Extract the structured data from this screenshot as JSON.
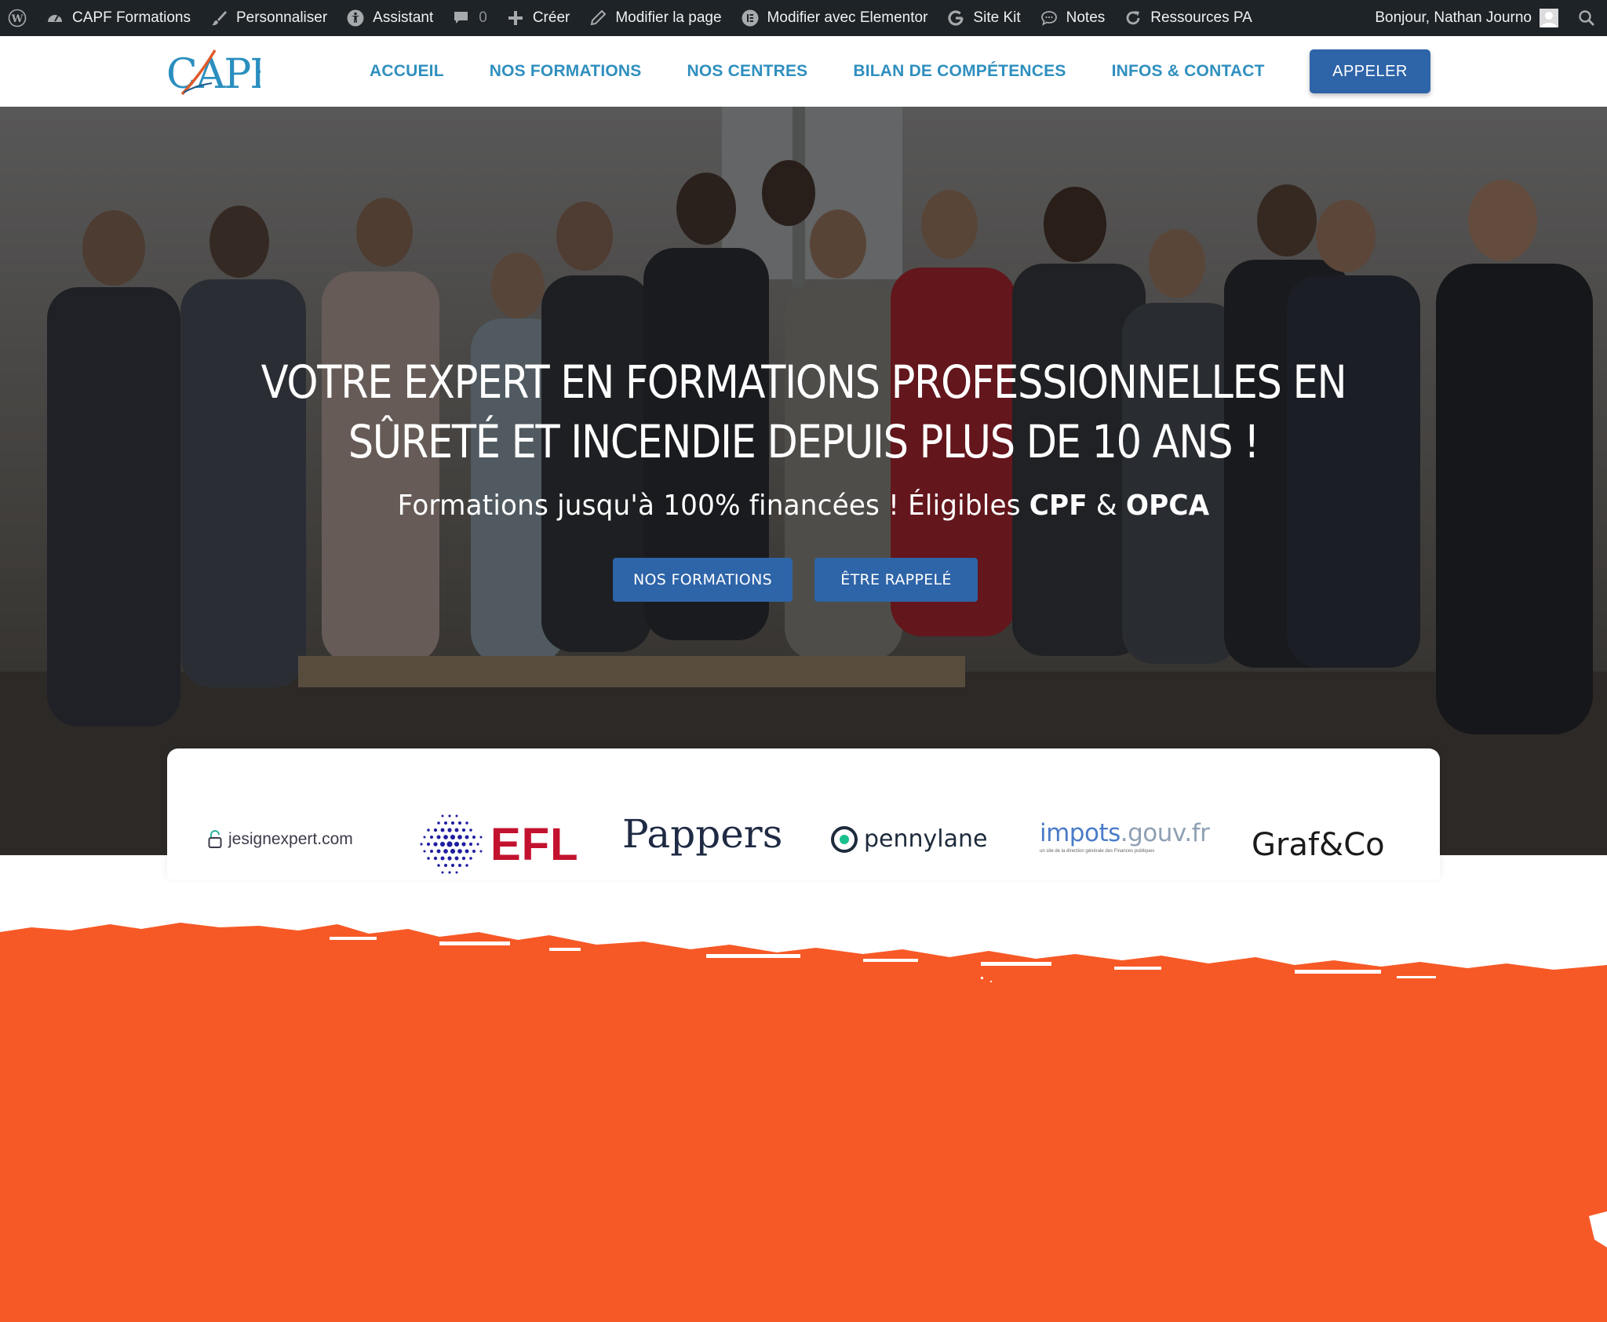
{
  "adminbar": {
    "site_name": "CAPF Formations",
    "customize": "Personnaliser",
    "assistant": "Assistant",
    "comments_count": "0",
    "create": "Créer",
    "edit_page": "Modifier la page",
    "edit_elementor": "Modifier avec Elementor",
    "site_kit": "Site Kit",
    "notes": "Notes",
    "resources": "Ressources PA",
    "greeting": "Bonjour, Nathan Journo"
  },
  "header": {
    "logo_text": "CAPF",
    "nav": [
      "ACCUEIL",
      "NOS FORMATIONS",
      "NOS CENTRES",
      "BILAN DE COMPÉTENCES",
      "INFOS & CONTACT"
    ],
    "cta": "APPELER"
  },
  "hero": {
    "title_line1": "VOTRE EXPERT EN FORMATIONS PROFESSIONNELLES EN",
    "title_line2": "SÛRETÉ ET INCENDIE DEPUIS PLUS DE 10 ANS !",
    "subtitle_pre": "Formations jusqu'à 100% financées ! Éligibles ",
    "subtitle_cpf": "CPF",
    "subtitle_amp": " & ",
    "subtitle_opca": "OPCA",
    "btn_formations": "NOS FORMATIONS",
    "btn_rappele": "ÊTRE RAPPELÉ"
  },
  "partners": {
    "jesign": "jesignexpert.com",
    "efl": "EFL",
    "pappers": "Pappers",
    "pennylane": "pennylane",
    "impots_main": "impots",
    "impots_suffix": ".gouv.fr",
    "impots_tagline": "un site de la direction générale des Finances publiques",
    "grafco": "Graf&Co"
  },
  "colors": {
    "adminbar_bg": "#1d2327",
    "nav_link": "#2f8fbf",
    "button_blue": "#2e64a8",
    "brush_orange": "#f75926",
    "efl_red": "#c3122f",
    "efl_blue": "#1e1ea0"
  }
}
